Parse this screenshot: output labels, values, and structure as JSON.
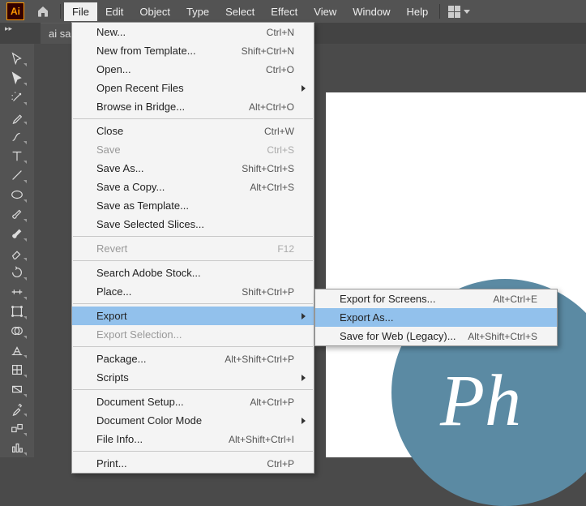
{
  "app": {
    "abbrev": "Ai",
    "tab_title": "ai sam"
  },
  "menus": [
    "File",
    "Edit",
    "Object",
    "Type",
    "Select",
    "Effect",
    "View",
    "Window",
    "Help"
  ],
  "file_menu": [
    {
      "label": "New...",
      "shortcut": "Ctrl+N"
    },
    {
      "label": "New from Template...",
      "shortcut": "Shift+Ctrl+N"
    },
    {
      "label": "Open...",
      "shortcut": "Ctrl+O"
    },
    {
      "label": "Open Recent Files",
      "submenu": true
    },
    {
      "label": "Browse in Bridge...",
      "shortcut": "Alt+Ctrl+O"
    },
    {
      "sep": true
    },
    {
      "label": "Close",
      "shortcut": "Ctrl+W"
    },
    {
      "label": "Save",
      "shortcut": "Ctrl+S",
      "disabled": true
    },
    {
      "label": "Save As...",
      "shortcut": "Shift+Ctrl+S"
    },
    {
      "label": "Save a Copy...",
      "shortcut": "Alt+Ctrl+S"
    },
    {
      "label": "Save as Template..."
    },
    {
      "label": "Save Selected Slices..."
    },
    {
      "sep": true
    },
    {
      "label": "Revert",
      "shortcut": "F12",
      "disabled": true
    },
    {
      "sep": true
    },
    {
      "label": "Search Adobe Stock..."
    },
    {
      "label": "Place...",
      "shortcut": "Shift+Ctrl+P"
    },
    {
      "sep": true
    },
    {
      "label": "Export",
      "submenu": true,
      "hover": true
    },
    {
      "label": "Export Selection...",
      "disabled": true
    },
    {
      "sep": true
    },
    {
      "label": "Package...",
      "shortcut": "Alt+Shift+Ctrl+P"
    },
    {
      "label": "Scripts",
      "submenu": true
    },
    {
      "sep": true
    },
    {
      "label": "Document Setup...",
      "shortcut": "Alt+Ctrl+P"
    },
    {
      "label": "Document Color Mode",
      "submenu": true
    },
    {
      "label": "File Info...",
      "shortcut": "Alt+Shift+Ctrl+I"
    },
    {
      "sep": true
    },
    {
      "label": "Print...",
      "shortcut": "Ctrl+P"
    }
  ],
  "export_menu": [
    {
      "label": "Export for Screens...",
      "shortcut": "Alt+Ctrl+E"
    },
    {
      "label": "Export As...",
      "hover": true
    },
    {
      "label": "Save for Web (Legacy)...",
      "shortcut": "Alt+Shift+Ctrl+S"
    }
  ],
  "canvas": {
    "logo_text": "Ph"
  }
}
